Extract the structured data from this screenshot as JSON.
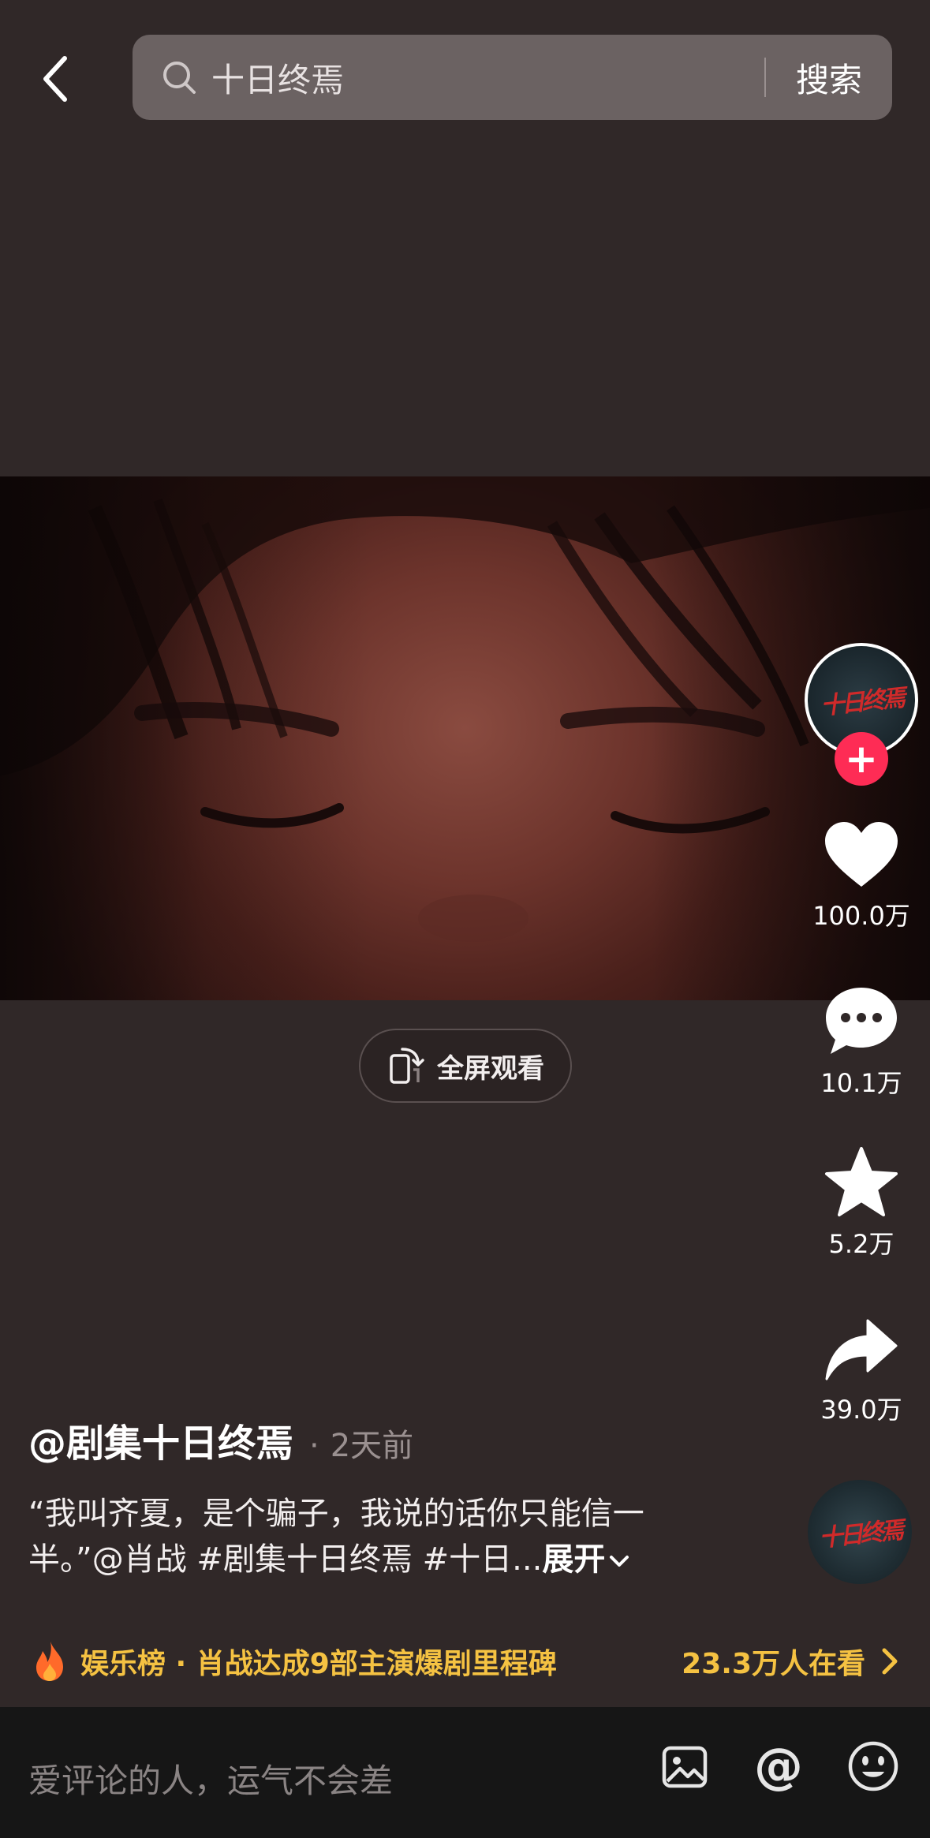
{
  "header": {
    "search_query": "十日终焉",
    "search_button": "搜索"
  },
  "video": {
    "fullscreen_label": "全屏观看"
  },
  "actions": {
    "like_count": "100.0万",
    "comment_count": "10.1万",
    "favorite_count": "5.2万",
    "share_count": "39.0万"
  },
  "author": {
    "name": "@剧集十日终焉",
    "dot": "·",
    "time": "2天前",
    "logo_text": "十日终焉"
  },
  "description": {
    "line1": "“我叫齐夏，是个骗子，我说的话你只能信一",
    "line2": "半。”@肖战 #剧集十日终焉 #十日...",
    "expand": "展开"
  },
  "hot_banner": {
    "title": "娱乐榜 · 肖战达成9部主演爆剧里程碑",
    "count": "23.3万人在看"
  },
  "comment_bar": {
    "placeholder": "爱评论的人，运气不会差",
    "at_symbol": "@"
  },
  "colors": {
    "background": "#302828",
    "accent_pink": "#fe2c55",
    "hot_yellow": "#f5c242",
    "comment_bar": "#161616"
  },
  "icons": [
    "back-arrow-icon",
    "search-icon",
    "rotate-phone-icon",
    "heart-icon",
    "comment-bubble-icon",
    "star-icon",
    "share-arrow-icon",
    "fire-icon",
    "chevron-right-icon",
    "chevron-down-icon",
    "image-icon",
    "at-icon",
    "emoji-icon"
  ]
}
